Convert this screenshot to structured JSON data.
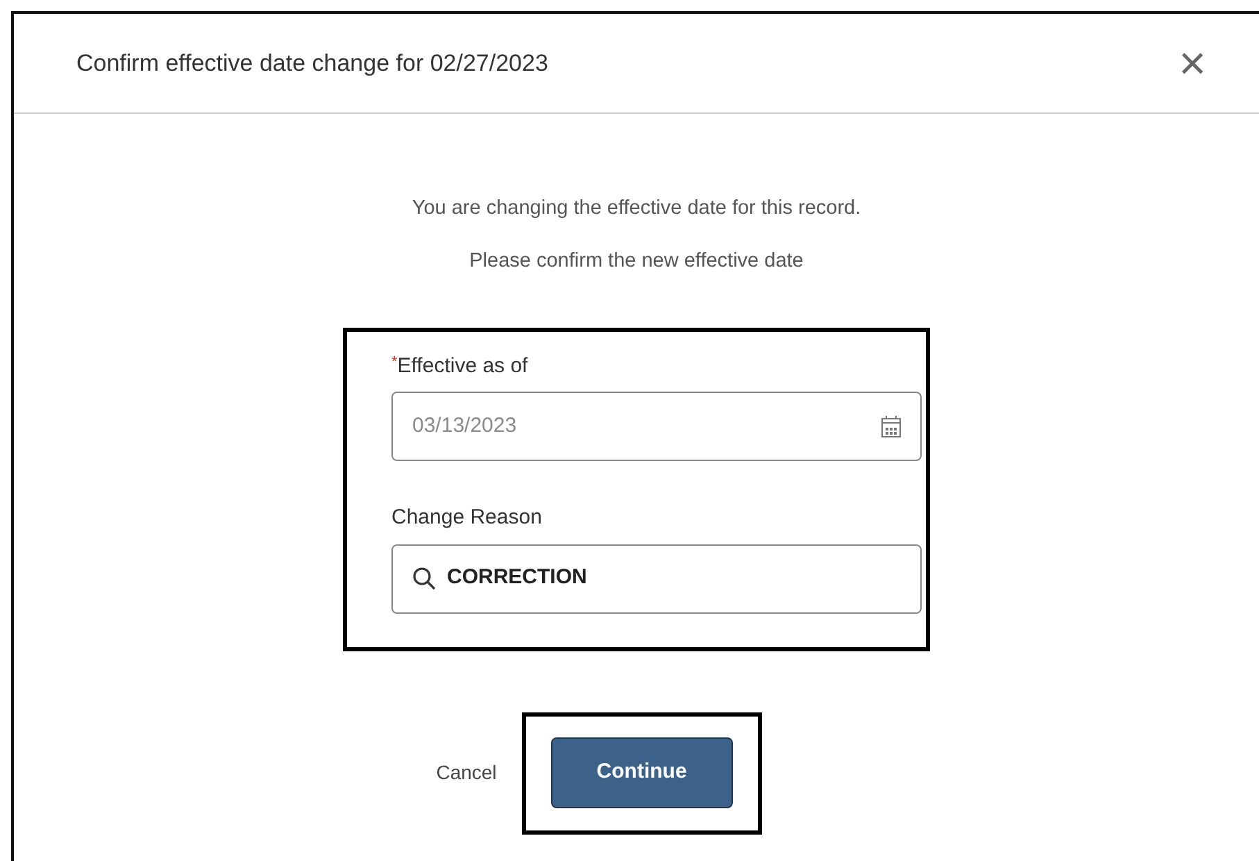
{
  "dialog": {
    "title": "Confirm effective date change for 02/27/2023",
    "close": "×"
  },
  "message": [
    "You are changing the effective date for this record.",
    "Please confirm the new effective date"
  ],
  "fields": [
    {
      "kind": "date",
      "label": "Effective as of",
      "required_mark": "*",
      "value": "03/13/2023"
    },
    {
      "kind": "lookup",
      "label": "Change Reason",
      "value": "CORRECTION"
    }
  ],
  "buttons": [
    {
      "label": "Cancel",
      "kind": "link"
    },
    {
      "label": "Continue",
      "kind": "primary"
    }
  ]
}
